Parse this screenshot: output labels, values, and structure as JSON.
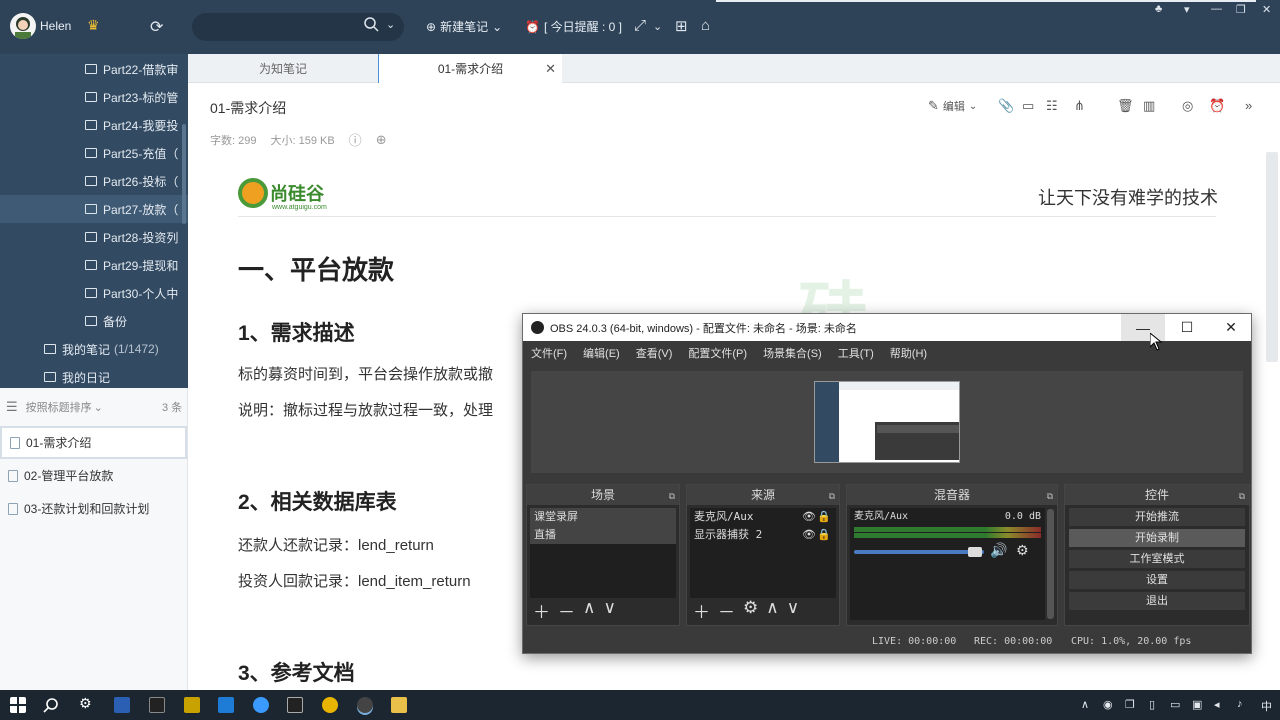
{
  "wiz": {
    "user": "Helen",
    "new_note": "新建笔记",
    "reminder": "[ 今日提醒 : 0 ]",
    "tree": [
      {
        "label": "Part22-借款审"
      },
      {
        "label": "Part23-标的管"
      },
      {
        "label": "Part24-我要投"
      },
      {
        "label": "Part25-充值（"
      },
      {
        "label": "Part26-投标（"
      },
      {
        "label": "Part27-放款（"
      },
      {
        "label": "Part28-投资列"
      },
      {
        "label": "Part29-提现和"
      },
      {
        "label": "Part30-个人中"
      },
      {
        "label": "备份"
      }
    ],
    "my_notes": "我的笔记",
    "my_notes_count": "(1/1472)",
    "my_diary": "我的日记",
    "sort_label": "按照标题排序",
    "note_count": "3 条",
    "notes": [
      {
        "title": "01-需求介绍"
      },
      {
        "title": "02-管理平台放款"
      },
      {
        "title": "03-还款计划和回款计划"
      }
    ],
    "tabs": [
      {
        "label": "为知笔记"
      },
      {
        "label": "01-需求介绍"
      }
    ],
    "note_title": "01-需求介绍",
    "word_count": "字数: 299",
    "size": "大小: 159 KB",
    "edit_label": "编辑"
  },
  "doc": {
    "logo_text": "尚硅谷",
    "logo_sub": "www.atguigu.com",
    "slogan": "让天下没有难学的技术",
    "h1": "一、平台放款",
    "s1": "1、需求描述",
    "p1": "标的募资时间到，平台会操作放款或撤",
    "p2": "说明：撤标过程与放款过程一致，处理",
    "s2": "2、相关数据库表",
    "p3": "还款人还款记录：lend_return",
    "p4": "投资人回款记录：lend_item_return",
    "s3": "3、参考文档"
  },
  "obs": {
    "title": "OBS 24.0.3 (64-bit, windows) - 配置文件: 未命名 - 场景: 未命名",
    "menu": [
      "文件(F)",
      "编辑(E)",
      "查看(V)",
      "配置文件(P)",
      "场景集合(S)",
      "工具(T)",
      "帮助(H)"
    ],
    "docks": {
      "scenes": "场景",
      "sources": "来源",
      "mixer": "混音器",
      "controls": "控件"
    },
    "scenes": [
      "课堂录屏",
      "直播"
    ],
    "sources": [
      "麦克风/Aux",
      "显示器捕获 2"
    ],
    "mixer_channel": "麦克风/Aux",
    "mixer_db": "0.0 dB",
    "controls": [
      "开始推流",
      "开始录制",
      "工作室模式",
      "设置",
      "退出"
    ],
    "live": "LIVE: 00:00:00",
    "rec": "REC: 00:00:00",
    "cpu": "CPU: 1.0%, 20.00 fps"
  },
  "taskbar": {
    "ime": "中"
  }
}
